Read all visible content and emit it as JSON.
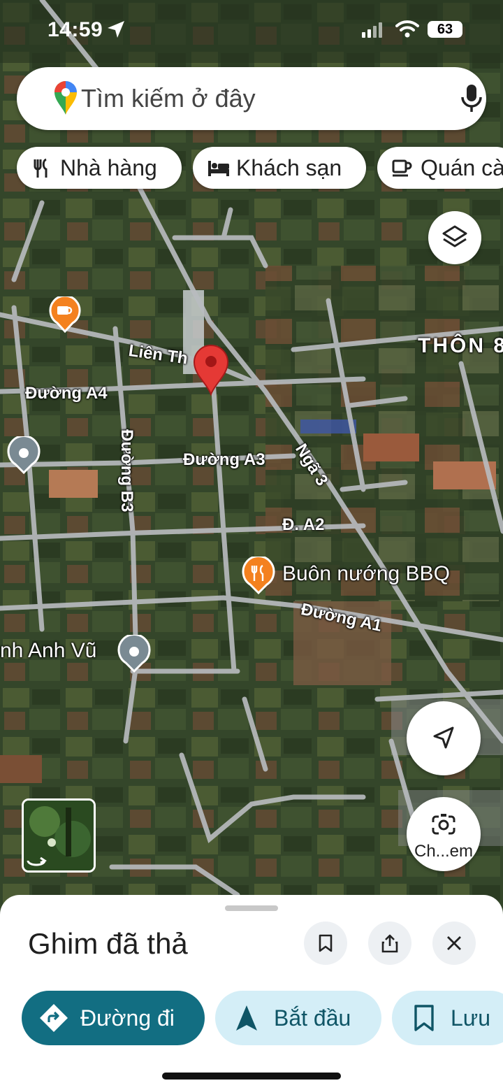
{
  "status_bar": {
    "time": "14:59",
    "battery": "63"
  },
  "search": {
    "placeholder": "Tìm kiếm ở đây"
  },
  "chips": [
    {
      "label": "Nhà hàng",
      "icon": "restaurant-icon"
    },
    {
      "label": "Khách sạn",
      "icon": "hotel-icon"
    },
    {
      "label": "Quán cà phê",
      "icon": "coffee-icon"
    }
  ],
  "map": {
    "place_label": "THÔN 8",
    "road_labels": {
      "lien_thon": "Liên Th",
      "a4": "Đường A4",
      "a3": "Đường A3",
      "b3": "Đường B3",
      "nga3": "Ngã 3",
      "a2": "Đ. A2",
      "a1": "Đường A1"
    },
    "pois": {
      "bbq": "Buôn nướng BBQ",
      "anh_vu": "nh Anh Vũ"
    }
  },
  "camera_button": {
    "label": "Ch...em"
  },
  "sheet": {
    "title": "Ghim đã thả",
    "buttons": {
      "directions": "Đường đi",
      "start": "Bắt đầu",
      "save": "Lưu"
    }
  },
  "colors": {
    "accent": "#126e82",
    "pill_light": "#d4eef7",
    "pin_red": "#e53935",
    "poi_orange": "#f4811f"
  }
}
